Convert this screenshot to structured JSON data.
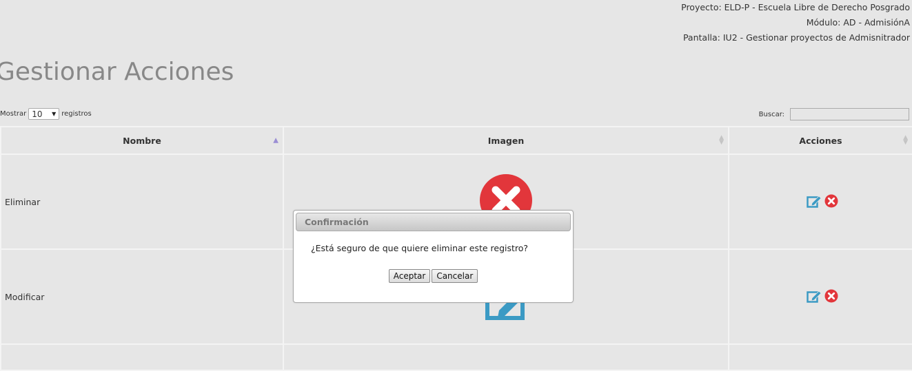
{
  "header": {
    "project": "Proyecto: ELD-P - Escuela Libre de Derecho Posgrado",
    "module": "Módulo: AD - AdmisiónA",
    "screen": "Pantalla: IU2 - Gestionar proyectos de Admisnitrador"
  },
  "page_title": "Gestionar Acciones",
  "length_control": {
    "prefix": "Mostrar",
    "value": "10",
    "suffix": "registros"
  },
  "search": {
    "label": "Buscar:",
    "value": ""
  },
  "table": {
    "columns": [
      "Nombre",
      "Imagen",
      "Acciones"
    ],
    "rows": [
      {
        "name": "Eliminar",
        "image_icon": "delete-x-icon"
      },
      {
        "name": "Modificar",
        "image_icon": "edit-icon"
      }
    ],
    "action_icons": [
      "edit-icon",
      "delete-icon"
    ]
  },
  "dialog": {
    "title": "Confirmación",
    "message": "¿Está seguro de que quiere eliminar este registro?",
    "accept_label": "Aceptar",
    "cancel_label": "Cancelar"
  },
  "colors": {
    "background": "#e6e6e6",
    "delete_red": "#e2363b",
    "edit_blue": "#3b9ac4",
    "sort_active": "#9b8ed4"
  }
}
